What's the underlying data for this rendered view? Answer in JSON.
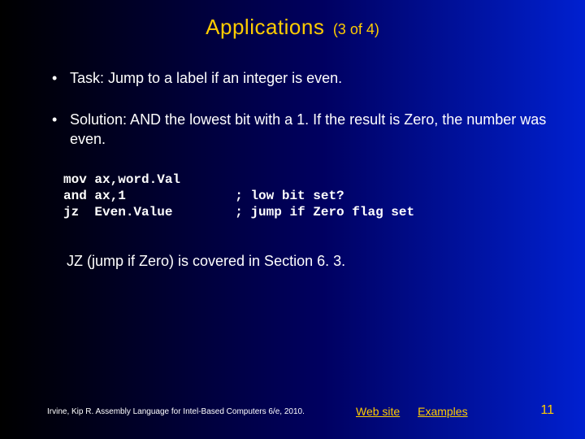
{
  "title": {
    "main": "Applications",
    "sub": "(3 of 4)"
  },
  "bullets": [
    "Task: Jump to a label if an integer is even.",
    "Solution: AND the lowest bit with a 1. If the result is Zero, the number was even."
  ],
  "code": "mov ax,word.Val\nand ax,1              ; low bit set?\njz  Even.Value        ; jump if Zero flag set",
  "note": "JZ (jump if Zero) is covered in Section 6. 3.",
  "footer": {
    "credit": "Irvine, Kip R. Assembly Language for Intel-Based Computers 6/e, 2010.",
    "links": {
      "website": "Web site",
      "examples": "Examples"
    },
    "page": "11"
  }
}
